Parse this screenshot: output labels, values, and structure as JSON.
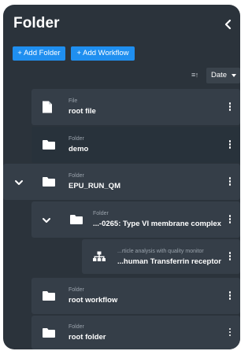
{
  "header": {
    "title": "Folder"
  },
  "toolbar": {
    "add_folder_label": "+ Add Folder",
    "add_workflow_label": "+ Add Workflow"
  },
  "sort": {
    "icon_glyph": "≡↑",
    "selected": "Date"
  },
  "tree": [
    {
      "type": "File",
      "name": "root file",
      "icon": "file-icon"
    },
    {
      "type": "Folder",
      "name": "demo",
      "icon": "folder-icon",
      "selected": true
    },
    {
      "type": "Folder",
      "name": "EPU_RUN_QM",
      "icon": "folder-icon",
      "expanded": true
    },
    {
      "type": "Folder",
      "name": "...-0265: Type VI membrane complex",
      "icon": "folder-icon",
      "expanded": true
    },
    {
      "type": "...rticle analysis with quality monitor",
      "name": "...human Transferrin receptor",
      "icon": "workflow-icon"
    },
    {
      "type": "Folder",
      "name": "root workflow",
      "icon": "folder-icon"
    },
    {
      "type": "Folder",
      "name": "root folder",
      "icon": "folder-icon"
    }
  ],
  "colors": {
    "panel": "#2b333b",
    "row": "#353e48",
    "row_selected": "#28323b",
    "accent": "#1f8ff0"
  }
}
